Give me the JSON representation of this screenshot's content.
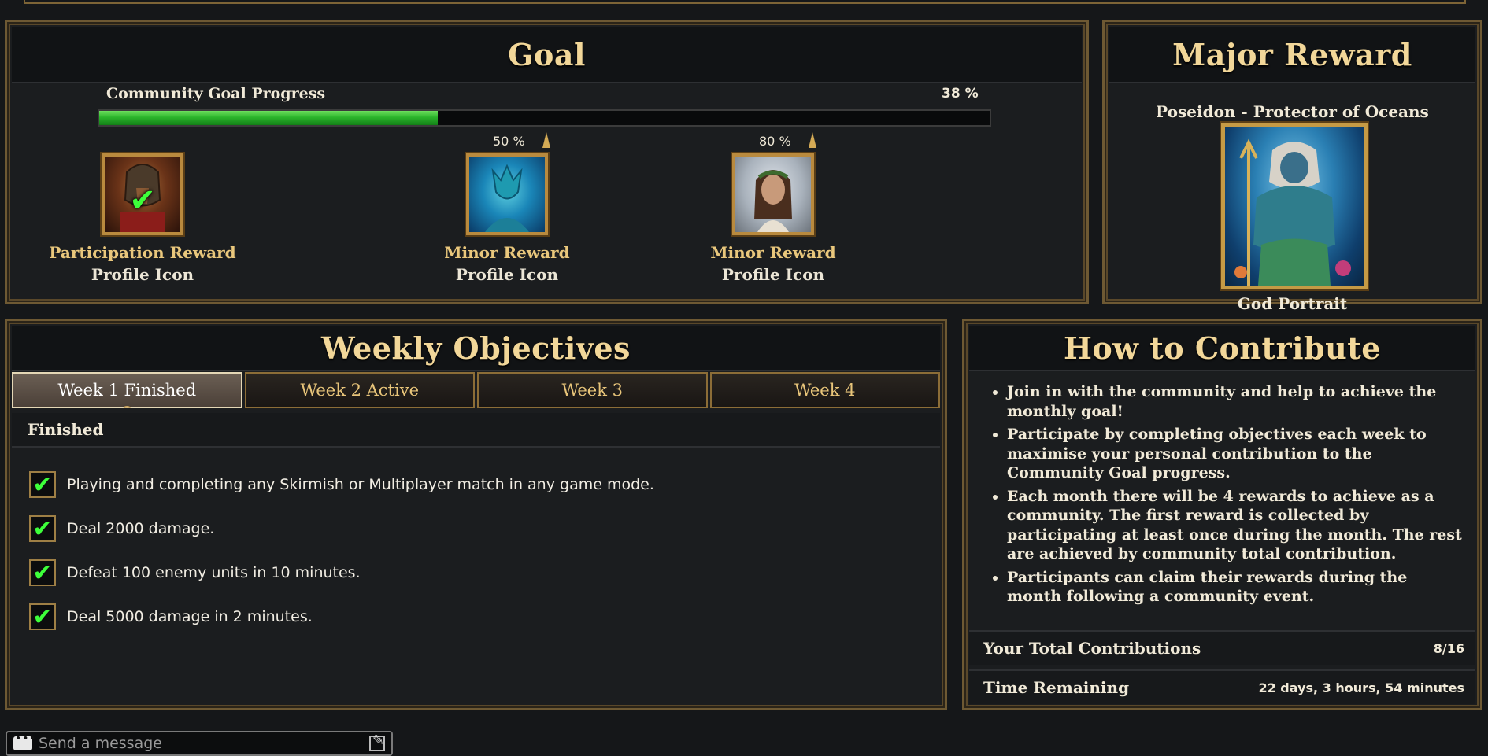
{
  "goal": {
    "title": "Goal",
    "progress_label": "Community Goal Progress",
    "progress_percent_text": "38 %",
    "progress_value": 0.38,
    "rewards": [
      {
        "title": "Participation Reward",
        "subtitle": "Profile Icon",
        "milestone_text": "",
        "claimed": true
      },
      {
        "title": "Minor Reward",
        "subtitle": "Profile Icon",
        "milestone_text": "50 %",
        "milestone_value": 0.5,
        "claimed": false
      },
      {
        "title": "Minor Reward",
        "subtitle": "Profile Icon",
        "milestone_text": "80 %",
        "milestone_value": 0.8,
        "claimed": false
      }
    ]
  },
  "major_reward": {
    "title": "Major Reward",
    "name": "Poseidon - Protector of Oceans",
    "subtitle": "God Portrait"
  },
  "weekly": {
    "title": "Weekly Objectives",
    "tabs": [
      {
        "label": "Week 1 Finished",
        "active": true
      },
      {
        "label": "Week 2 Active",
        "active": false
      },
      {
        "label": "Week 3",
        "active": false
      },
      {
        "label": "Week 4",
        "active": false
      }
    ],
    "status": "Finished",
    "objectives": [
      {
        "text": "Playing and completing any Skirmish or Multiplayer match in any game mode.",
        "done": true
      },
      {
        "text": "Deal 2000 damage.",
        "done": true
      },
      {
        "text": "Defeat 100 enemy units in 10 minutes.",
        "done": true
      },
      {
        "text": "Deal 5000 damage in 2 minutes.",
        "done": true
      }
    ]
  },
  "how": {
    "title": "How to Contribute",
    "bullets": [
      "Join in with the community and help to achieve the monthly goal!",
      "Participate by completing objectives each week to maximise your personal contribution to the Community Goal progress.",
      "Each month there will be 4 rewards to achieve as a community. The first reward is collected by participating at least once during the month. The rest are achieved by community total contribution.",
      "Participants can claim their rewards during the month following a community event."
    ],
    "total_label": "Your Total Contributions",
    "total_value": "8/16",
    "time_label": "Time Remaining",
    "time_value": "22 days, 3 hours, 54 minutes"
  },
  "chat": {
    "placeholder": "Send a message"
  },
  "colors": {
    "accent_gold": "#f2d799",
    "frame_gold": "#6e5933",
    "progress_green": "#2bb52b",
    "check_green": "#3dff3a"
  },
  "icons": {
    "checkmark": "check-icon",
    "milestone": "milestone-marker-icon",
    "chat": "chat-bubble-icon",
    "edit": "edit-icon"
  }
}
